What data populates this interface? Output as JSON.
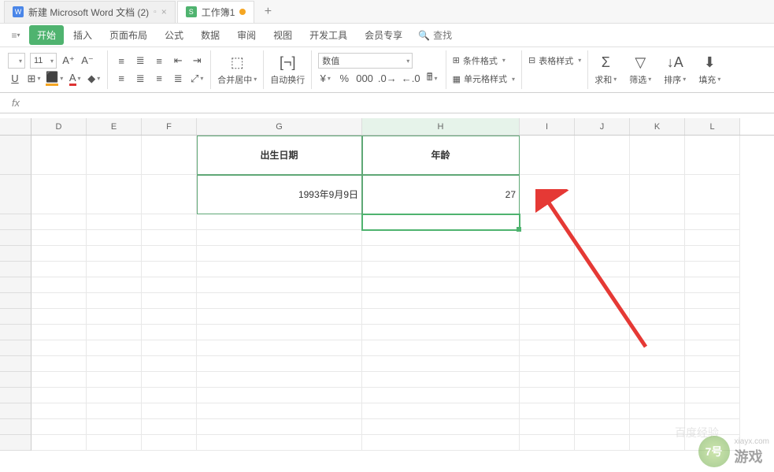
{
  "tabs": {
    "doc1": "新建 Microsoft Word 文档 (2)",
    "doc2": "工作簿1"
  },
  "menu": {
    "start": "开始",
    "insert": "插入",
    "layout": "页面布局",
    "formula": "公式",
    "data": "数据",
    "review": "审阅",
    "view": "视图",
    "dev": "开发工具",
    "vip": "会员专享",
    "search_placeholder": "查找"
  },
  "toolbar": {
    "font_size": "11",
    "merge": "合并居中",
    "wrap": "自动换行",
    "number_format": "数值",
    "cond_fmt": "条件格式",
    "table_style": "表格样式",
    "cell_style": "单元格样式",
    "sum": "求和",
    "filter": "筛选",
    "sort": "排序",
    "fill": "填充"
  },
  "columns": [
    "D",
    "E",
    "F",
    "G",
    "H",
    "I",
    "J",
    "K",
    "L"
  ],
  "sheet": {
    "g_header": "出生日期",
    "h_header": "年龄",
    "g_value": "1993年9月9日",
    "h_value": "27"
  },
  "watermark": {
    "site": "7号",
    "sub": "游戏",
    "url": "xiayx.com",
    "faint": "百度经验"
  }
}
